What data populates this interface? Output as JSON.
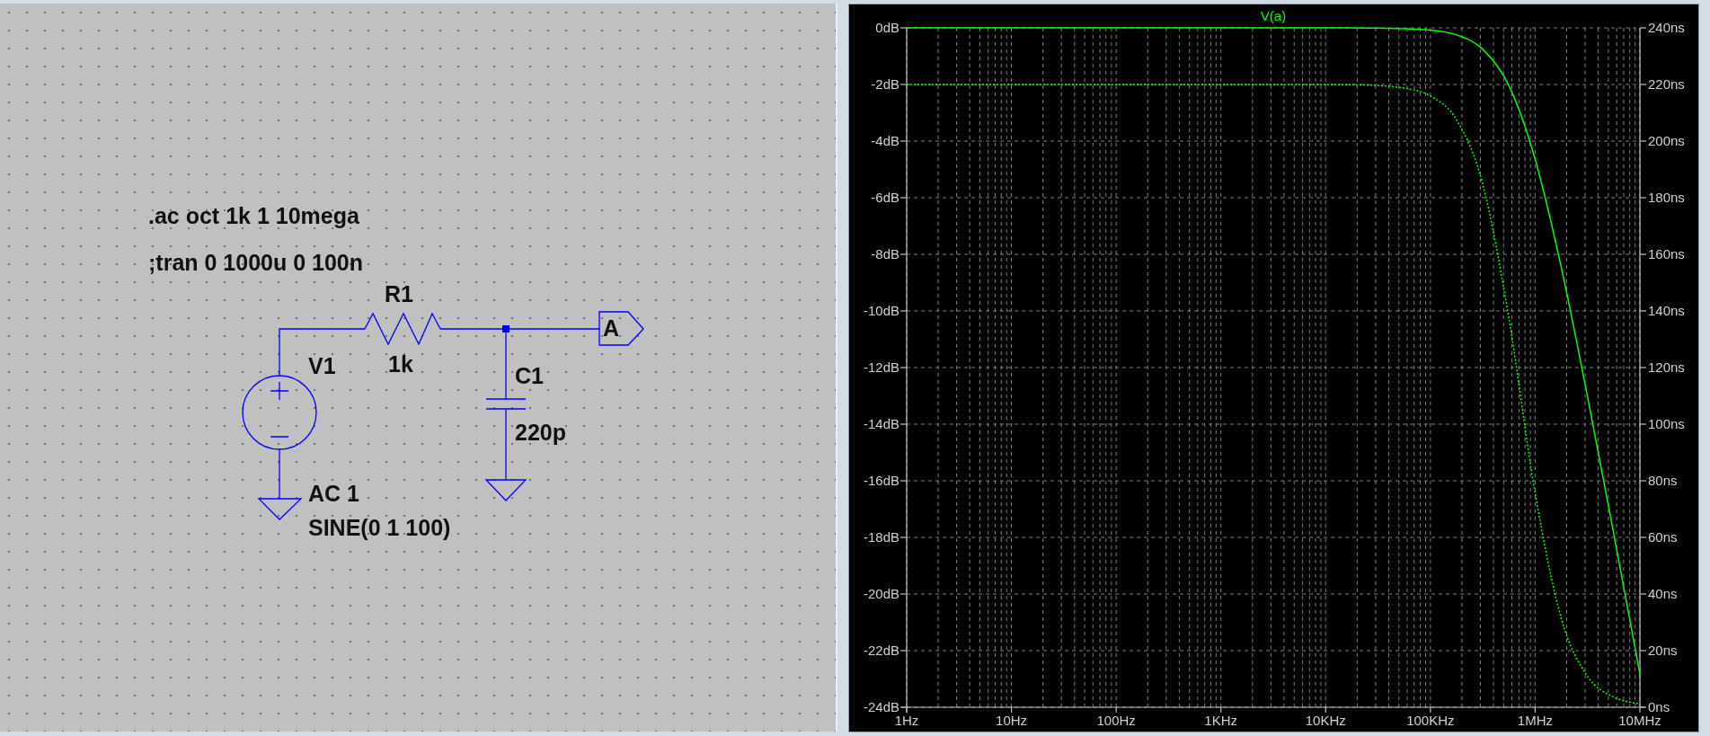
{
  "schematic": {
    "directives": [
      ".ac oct 1k 1 10mega",
      ";tran 0 1000u 0 100n"
    ],
    "components": [
      {
        "kind": "voltage_source",
        "name": "V1",
        "values": [
          "AC 1",
          "SINE(0 1 100)"
        ]
      },
      {
        "kind": "resistor",
        "name": "R1",
        "values": [
          "1k"
        ]
      },
      {
        "kind": "capacitor",
        "name": "C1",
        "values": [
          "220p"
        ]
      }
    ],
    "net_label": "A"
  },
  "plot": {
    "chart_data": {
      "type": "line",
      "title": "V(a)",
      "grid": true,
      "categories": [
        "1Hz",
        null,
        null,
        null,
        "10Hz",
        null,
        null,
        null,
        "100Hz",
        null,
        null,
        null,
        "1KHz",
        null,
        null,
        null,
        "10KHz",
        null,
        null,
        null,
        "100KHz",
        null,
        null,
        null,
        "1MHz",
        null,
        null,
        null,
        "10MHz"
      ],
      "ylim": [
        -24,
        0
      ],
      "yticks": [
        {
          "value": 0,
          "label": "0dB"
        },
        {
          "value": -2,
          "label": "-2dB"
        },
        {
          "value": -4,
          "label": "-4dB"
        },
        {
          "value": -6,
          "label": "-6dB"
        },
        {
          "value": -8,
          "label": "-8dB"
        },
        {
          "value": -10,
          "label": "-10dB"
        },
        {
          "value": -12,
          "label": "-12dB"
        },
        {
          "value": -14,
          "label": "-14dB"
        },
        {
          "value": -16,
          "label": "-16dB"
        },
        {
          "value": -18,
          "label": "-18dB"
        },
        {
          "value": -20,
          "label": "-20dB"
        },
        {
          "value": -22,
          "label": "-22dB"
        },
        {
          "value": -24,
          "label": "-24dB"
        }
      ],
      "y2lim": [
        0,
        240
      ],
      "y2ticks": [
        {
          "value": 240,
          "label": "240ns"
        },
        {
          "value": 220,
          "label": "220ns"
        },
        {
          "value": 200,
          "label": "200ns"
        },
        {
          "value": 180,
          "label": "180ns"
        },
        {
          "value": 160,
          "label": "160ns"
        },
        {
          "value": 140,
          "label": "140ns"
        },
        {
          "value": 120,
          "label": "120ns"
        },
        {
          "value": 100,
          "label": "100ns"
        },
        {
          "value": 80,
          "label": "80ns"
        },
        {
          "value": 60,
          "label": "60ns"
        },
        {
          "value": 40,
          "label": "40ns"
        },
        {
          "value": 20,
          "label": "20ns"
        },
        {
          "value": 0,
          "label": "0ns"
        }
      ],
      "series": [
        {
          "color": "#00ff00",
          "values": [
            0,
            0,
            0,
            0,
            0,
            0,
            0,
            0,
            0,
            0,
            0,
            0,
            0,
            0,
            0,
            0,
            0,
            0,
            -0.01,
            -0.03,
            -0.08,
            -0.25,
            -0.76,
            -2.05,
            -4.64,
            -8.48,
            -13.03,
            -17.88,
            -22.83
          ]
        },
        {
          "axis": "y2",
          "line_style": "dotted",
          "color": "#00ff00",
          "values": [
            220,
            220,
            220,
            220,
            220,
            220,
            220,
            220,
            220,
            220,
            220,
            220,
            220,
            220,
            220,
            220,
            220,
            219.9,
            219.6,
            218.7,
            215.9,
            207.5,
            184.7,
            137.1,
            75.6,
            31.2,
            10.9,
            3.6,
            1.1
          ]
        }
      ]
    }
  }
}
